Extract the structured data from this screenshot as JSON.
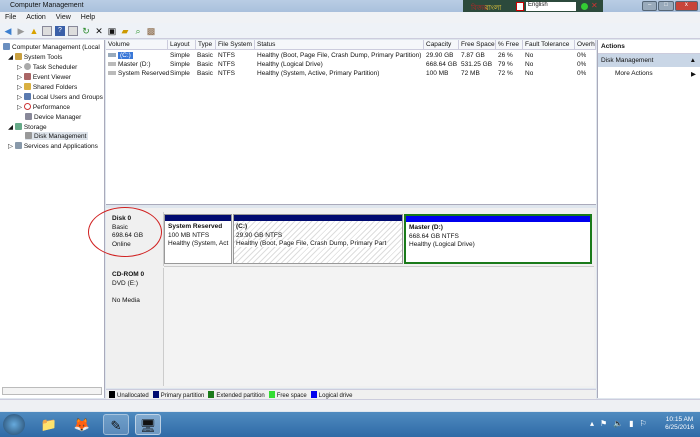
{
  "window": {
    "title": "Computer Management"
  },
  "ime": {
    "brand_icon_text": "বিজয়",
    "brand": "বাংলা",
    "language": "English"
  },
  "menu": [
    "File",
    "Action",
    "View",
    "Help"
  ],
  "tree": [
    {
      "label": "Computer Management (Local",
      "indent": 0
    },
    {
      "label": "System Tools",
      "indent": 1
    },
    {
      "label": "Task Scheduler",
      "indent": 2
    },
    {
      "label": "Event Viewer",
      "indent": 2
    },
    {
      "label": "Shared Folders",
      "indent": 2
    },
    {
      "label": "Local Users and Groups",
      "indent": 2
    },
    {
      "label": "Performance",
      "indent": 2
    },
    {
      "label": "Device Manager",
      "indent": 2
    },
    {
      "label": "Storage",
      "indent": 1
    },
    {
      "label": "Disk Management",
      "indent": 2
    },
    {
      "label": "Services and Applications",
      "indent": 1
    }
  ],
  "columns": [
    "Volume",
    "Layout",
    "Type",
    "File System",
    "Status",
    "Capacity",
    "Free Space",
    "% Free",
    "Fault Tolerance",
    "Overh"
  ],
  "rows": [
    [
      "(C:)",
      "Simple",
      "Basic",
      "NTFS",
      "Healthy (Boot, Page File, Crash Dump, Primary Partition)",
      "29.90 GB",
      "7.87 GB",
      "26 %",
      "No",
      "0%"
    ],
    [
      "Master (D:)",
      "Simple",
      "Basic",
      "NTFS",
      "Healthy (Logical Drive)",
      "668.64 GB",
      "531.25 GB",
      "79 %",
      "No",
      "0%"
    ],
    [
      "System Reserved",
      "Simple",
      "Basic",
      "NTFS",
      "Healthy (System, Active, Primary Partition)",
      "100 MB",
      "72 MB",
      "72 %",
      "No",
      "0%"
    ]
  ],
  "disks": [
    {
      "name": "Disk 0",
      "type": "Basic",
      "size": "698.64 GB",
      "state": "Online",
      "partitions": [
        {
          "name": "System Reserved",
          "size": "100 MB NTFS",
          "status": "Healthy (System, Act"
        },
        {
          "name": "(C:)",
          "size": "29.90 GB NTFS",
          "status": "Healthy (Boot, Page File, Crash Dump, Primary Part"
        },
        {
          "name": "Master  (D:)",
          "size": "668.64 GB NTFS",
          "status": "Healthy (Logical Drive)"
        }
      ]
    },
    {
      "name": "CD-ROM 0",
      "type": "DVD (E:)",
      "state": "No Media"
    }
  ],
  "legend": [
    {
      "label": "Unallocated",
      "color": "#000000"
    },
    {
      "label": "Primary partition",
      "color": "#000a70"
    },
    {
      "label": "Extended partition",
      "color": "#1a7a1a"
    },
    {
      "label": "Free space",
      "color": "#33dd33"
    },
    {
      "label": "Logical drive",
      "color": "#0000ee"
    }
  ],
  "actions": {
    "title": "Actions",
    "section": "Disk Management",
    "more": "More Actions"
  },
  "clock": {
    "time": "10:15 AM",
    "date": "6/25/2016"
  }
}
